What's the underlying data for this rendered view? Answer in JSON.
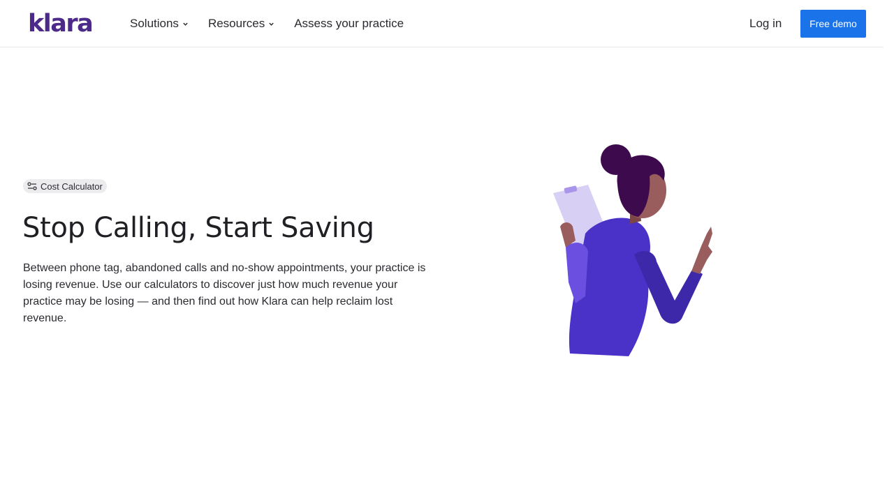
{
  "header": {
    "logo_text": "klara",
    "nav": [
      {
        "label": "Solutions",
        "has_dropdown": true
      },
      {
        "label": "Resources",
        "has_dropdown": true
      },
      {
        "label": "Assess your practice",
        "has_dropdown": false
      }
    ],
    "login_label": "Log in",
    "cta_label": "Free demo"
  },
  "hero": {
    "badge_label": "Cost Calculator",
    "badge_icon": "sliders-icon",
    "title": "Stop Calling, Start Saving",
    "description": "Between phone tag, abandoned calls and no-show appointments, your practice is losing revenue. Use our calculators to discover just how much revenue your practice may be losing — and then find out how Klara can help reclaim lost revenue."
  },
  "colors": {
    "brand": "#4b2a8a",
    "cta": "#1a73e8",
    "illustration_primary": "#4a32c8",
    "skin": "#9a5d5d",
    "hair": "#3d0a4d",
    "clipboard": "#d8cff5"
  }
}
